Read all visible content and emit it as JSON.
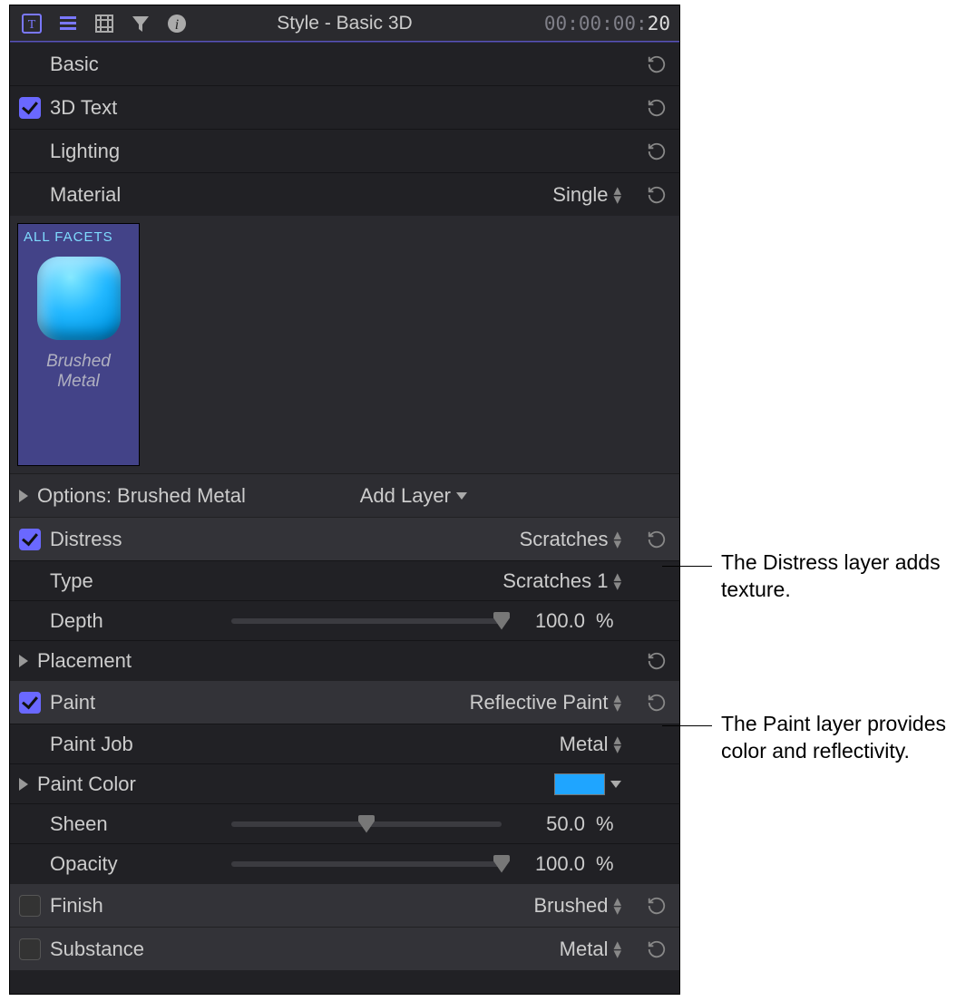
{
  "header": {
    "title": "Style - Basic 3D",
    "timecode_base": "00:00:00:",
    "timecode_frames": "20"
  },
  "sections": {
    "basic": {
      "label": "Basic"
    },
    "text3d": {
      "label": "3D Text",
      "checked": true
    },
    "lighting": {
      "label": "Lighting"
    },
    "material": {
      "label": "Material",
      "value": "Single"
    }
  },
  "facet": {
    "badge": "ALL FACETS",
    "name": "Brushed Metal"
  },
  "options": {
    "label": "Options: Brushed Metal",
    "add_layer": "Add Layer"
  },
  "distress": {
    "label": "Distress",
    "value": "Scratches",
    "checked": true,
    "type_label": "Type",
    "type_value": "Scratches 1",
    "depth_label": "Depth",
    "depth_value": "100.0",
    "depth_unit": "%",
    "depth_pct": 100
  },
  "placement": {
    "label": "Placement"
  },
  "paint": {
    "label": "Paint",
    "value": "Reflective Paint",
    "checked": true,
    "job_label": "Paint Job",
    "job_value": "Metal",
    "color_label": "Paint Color",
    "color_hex": "#1fa5ff",
    "sheen_label": "Sheen",
    "sheen_value": "50.0",
    "sheen_unit": "%",
    "sheen_pct": 50,
    "opacity_label": "Opacity",
    "opacity_value": "100.0",
    "opacity_unit": "%",
    "opacity_pct": 100
  },
  "finish": {
    "label": "Finish",
    "value": "Brushed",
    "checked": false
  },
  "substance": {
    "label": "Substance",
    "value": "Metal",
    "checked": false
  },
  "annotations": {
    "distress": "The Distress layer adds texture.",
    "paint": "The Paint layer provides color and reflectivity."
  }
}
